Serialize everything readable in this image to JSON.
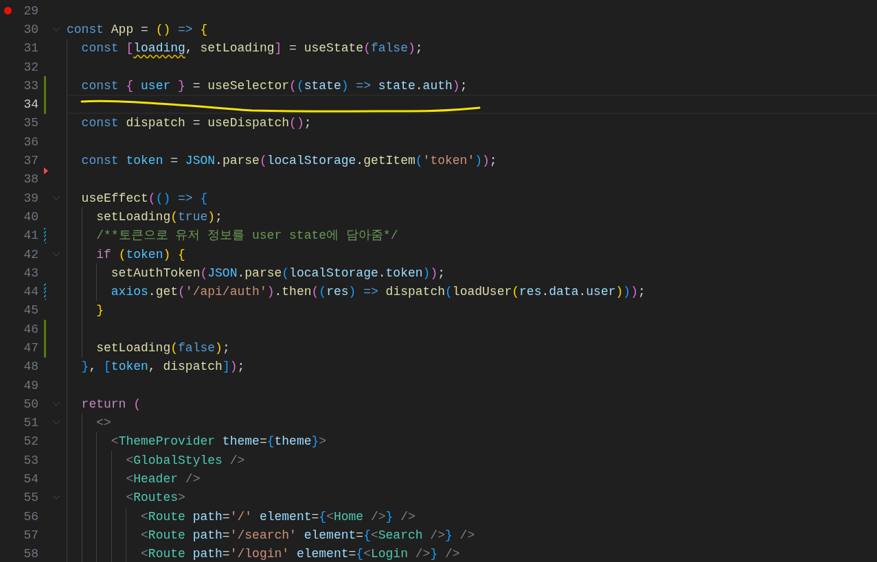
{
  "lines": [
    {
      "n": "29",
      "breakpoint": true
    },
    {
      "n": "30",
      "fold": true,
      "t": [
        {
          "text": "const ",
          "kind": "kw"
        },
        {
          "text": "App",
          "kind": "fn"
        },
        {
          "text": " = ",
          "kind": "p"
        },
        {
          "text": "()",
          "kind": "b1"
        },
        {
          "text": " => ",
          "kind": "kw"
        },
        {
          "text": "{",
          "kind": "b1"
        }
      ]
    },
    {
      "n": "31",
      "t": [
        {
          "text": "  const ",
          "kind": "kw"
        },
        {
          "text": "[",
          "kind": "b2"
        },
        {
          "text": "loading",
          "kind": "var-warn"
        },
        {
          "text": ", ",
          "kind": "p"
        },
        {
          "text": "setLoading",
          "kind": "fn"
        },
        {
          "text": "]",
          "kind": "b2"
        },
        {
          "text": " = ",
          "kind": "p"
        },
        {
          "text": "useState",
          "kind": "fn"
        },
        {
          "text": "(",
          "kind": "b2"
        },
        {
          "text": "false",
          "kind": "kw"
        },
        {
          "text": ")",
          "kind": "b2"
        },
        {
          "text": ";",
          "kind": "p"
        }
      ]
    },
    {
      "n": "32"
    },
    {
      "n": "33",
      "added": true,
      "t": [
        {
          "text": "  const ",
          "kind": "kw"
        },
        {
          "text": "{ ",
          "kind": "b2"
        },
        {
          "text": "user ",
          "kind": "cst"
        },
        {
          "text": "}",
          "kind": "b2"
        },
        {
          "text": " = ",
          "kind": "p"
        },
        {
          "text": "useSelector",
          "kind": "fn"
        },
        {
          "text": "(",
          "kind": "b2"
        },
        {
          "text": "(",
          "kind": "b3"
        },
        {
          "text": "state",
          "kind": "var"
        },
        {
          "text": ")",
          "kind": "b3"
        },
        {
          "text": " => ",
          "kind": "kw"
        },
        {
          "text": "state",
          "kind": "var"
        },
        {
          "text": ".",
          "kind": "p"
        },
        {
          "text": "auth",
          "kind": "var"
        },
        {
          "text": ")",
          "kind": "b2"
        },
        {
          "text": ";",
          "kind": "p"
        }
      ]
    },
    {
      "n": "34",
      "added": true,
      "current": true
    },
    {
      "n": "35",
      "t": [
        {
          "text": "  const ",
          "kind": "kw"
        },
        {
          "text": "dispatch",
          "kind": "fn"
        },
        {
          "text": " = ",
          "kind": "p"
        },
        {
          "text": "useDispatch",
          "kind": "fn"
        },
        {
          "text": "()",
          "kind": "b2"
        },
        {
          "text": ";",
          "kind": "p"
        }
      ]
    },
    {
      "n": "36"
    },
    {
      "n": "37",
      "deleted": true,
      "t": [
        {
          "text": "  const ",
          "kind": "kw"
        },
        {
          "text": "token",
          "kind": "cst"
        },
        {
          "text": " = ",
          "kind": "p"
        },
        {
          "text": "JSON",
          "kind": "cst"
        },
        {
          "text": ".",
          "kind": "p"
        },
        {
          "text": "parse",
          "kind": "fn"
        },
        {
          "text": "(",
          "kind": "b2"
        },
        {
          "text": "localStorage",
          "kind": "var"
        },
        {
          "text": ".",
          "kind": "p"
        },
        {
          "text": "getItem",
          "kind": "fn"
        },
        {
          "text": "(",
          "kind": "b3"
        },
        {
          "text": "'token'",
          "kind": "str"
        },
        {
          "text": ")",
          "kind": "b3"
        },
        {
          "text": ")",
          "kind": "b2"
        },
        {
          "text": ";",
          "kind": "p"
        }
      ]
    },
    {
      "n": "38"
    },
    {
      "n": "39",
      "fold": true,
      "t": [
        {
          "text": "  useEffect",
          "kind": "fn"
        },
        {
          "text": "(",
          "kind": "b2"
        },
        {
          "text": "()",
          "kind": "b3"
        },
        {
          "text": " => ",
          "kind": "kw"
        },
        {
          "text": "{",
          "kind": "b3"
        }
      ]
    },
    {
      "n": "40",
      "t": [
        {
          "text": "    setLoading",
          "kind": "fn"
        },
        {
          "text": "(",
          "kind": "b1"
        },
        {
          "text": "true",
          "kind": "kw"
        },
        {
          "text": ")",
          "kind": "b1"
        },
        {
          "text": ";",
          "kind": "p"
        }
      ]
    },
    {
      "n": "41",
      "modified": true,
      "t": [
        {
          "text": "    /**토큰으로 유저 정보를 user state에 담아줌*/",
          "kind": "cmt"
        }
      ]
    },
    {
      "n": "42",
      "fold": true,
      "t": [
        {
          "text": "    if ",
          "kind": "ctl"
        },
        {
          "text": "(",
          "kind": "b1"
        },
        {
          "text": "token",
          "kind": "cst"
        },
        {
          "text": ")",
          "kind": "b1"
        },
        {
          "text": " {",
          "kind": "b1"
        }
      ]
    },
    {
      "n": "43",
      "t": [
        {
          "text": "      setAuthToken",
          "kind": "fn"
        },
        {
          "text": "(",
          "kind": "b2"
        },
        {
          "text": "JSON",
          "kind": "cst"
        },
        {
          "text": ".",
          "kind": "p"
        },
        {
          "text": "parse",
          "kind": "fn"
        },
        {
          "text": "(",
          "kind": "b3"
        },
        {
          "text": "localStorage",
          "kind": "var"
        },
        {
          "text": ".",
          "kind": "p"
        },
        {
          "text": "token",
          "kind": "var"
        },
        {
          "text": ")",
          "kind": "b3"
        },
        {
          "text": ")",
          "kind": "b2"
        },
        {
          "text": ";",
          "kind": "p"
        }
      ]
    },
    {
      "n": "44",
      "modified": true,
      "t": [
        {
          "text": "      axios",
          "kind": "cst"
        },
        {
          "text": ".",
          "kind": "p"
        },
        {
          "text": "get",
          "kind": "fn"
        },
        {
          "text": "(",
          "kind": "b2"
        },
        {
          "text": "'/api/auth'",
          "kind": "str"
        },
        {
          "text": ")",
          "kind": "b2"
        },
        {
          "text": ".",
          "kind": "p"
        },
        {
          "text": "then",
          "kind": "fn"
        },
        {
          "text": "(",
          "kind": "b2"
        },
        {
          "text": "(",
          "kind": "b3"
        },
        {
          "text": "res",
          "kind": "var"
        },
        {
          "text": ")",
          "kind": "b3"
        },
        {
          "text": " => ",
          "kind": "kw"
        },
        {
          "text": "dispatch",
          "kind": "fn"
        },
        {
          "text": "(",
          "kind": "b3"
        },
        {
          "text": "loadUser",
          "kind": "fn"
        },
        {
          "text": "(",
          "kind": "b1"
        },
        {
          "text": "res",
          "kind": "var"
        },
        {
          "text": ".",
          "kind": "p"
        },
        {
          "text": "data",
          "kind": "var"
        },
        {
          "text": ".",
          "kind": "p"
        },
        {
          "text": "user",
          "kind": "var"
        },
        {
          "text": ")",
          "kind": "b1"
        },
        {
          "text": ")",
          "kind": "b3"
        },
        {
          "text": ")",
          "kind": "b2"
        },
        {
          "text": ";",
          "kind": "p"
        }
      ]
    },
    {
      "n": "45",
      "t": [
        {
          "text": "    }",
          "kind": "b1"
        }
      ]
    },
    {
      "n": "46",
      "added": true
    },
    {
      "n": "47",
      "added": true,
      "t": [
        {
          "text": "    setLoading",
          "kind": "fn"
        },
        {
          "text": "(",
          "kind": "b1"
        },
        {
          "text": "false",
          "kind": "kw"
        },
        {
          "text": ")",
          "kind": "b1"
        },
        {
          "text": ";",
          "kind": "p"
        }
      ]
    },
    {
      "n": "48",
      "t": [
        {
          "text": "  }",
          "kind": "b3"
        },
        {
          "text": ", ",
          "kind": "p"
        },
        {
          "text": "[",
          "kind": "b3"
        },
        {
          "text": "token",
          "kind": "cst"
        },
        {
          "text": ", ",
          "kind": "p"
        },
        {
          "text": "dispatch",
          "kind": "fn"
        },
        {
          "text": "]",
          "kind": "b3"
        },
        {
          "text": ")",
          "kind": "b2"
        },
        {
          "text": ";",
          "kind": "p"
        }
      ]
    },
    {
      "n": "49"
    },
    {
      "n": "50",
      "fold": true,
      "t": [
        {
          "text": "  return ",
          "kind": "ctl"
        },
        {
          "text": "(",
          "kind": "b2"
        }
      ]
    },
    {
      "n": "51",
      "fold": true,
      "t": [
        {
          "text": "    <>",
          "kind": "tb"
        }
      ]
    },
    {
      "n": "52",
      "t": [
        {
          "text": "      <",
          "kind": "tb"
        },
        {
          "text": "ThemeProvider",
          "kind": "tag"
        },
        {
          "text": " theme",
          "kind": "var"
        },
        {
          "text": "=",
          "kind": "p"
        },
        {
          "text": "{",
          "kind": "b3"
        },
        {
          "text": "theme",
          "kind": "var"
        },
        {
          "text": "}",
          "kind": "b3"
        },
        {
          "text": ">",
          "kind": "tb"
        }
      ]
    },
    {
      "n": "53",
      "t": [
        {
          "text": "        <",
          "kind": "tb"
        },
        {
          "text": "GlobalStyles",
          "kind": "tag"
        },
        {
          "text": " />",
          "kind": "tb"
        }
      ]
    },
    {
      "n": "54",
      "t": [
        {
          "text": "        <",
          "kind": "tb"
        },
        {
          "text": "Header",
          "kind": "tag"
        },
        {
          "text": " />",
          "kind": "tb"
        }
      ]
    },
    {
      "n": "55",
      "fold": true,
      "t": [
        {
          "text": "        <",
          "kind": "tb"
        },
        {
          "text": "Routes",
          "kind": "tag"
        },
        {
          "text": ">",
          "kind": "tb"
        }
      ]
    },
    {
      "n": "56",
      "t": [
        {
          "text": "          <",
          "kind": "tb"
        },
        {
          "text": "Route",
          "kind": "tag"
        },
        {
          "text": " path",
          "kind": "var"
        },
        {
          "text": "=",
          "kind": "p"
        },
        {
          "text": "'/'",
          "kind": "str"
        },
        {
          "text": " element",
          "kind": "var"
        },
        {
          "text": "=",
          "kind": "p"
        },
        {
          "text": "{",
          "kind": "b3"
        },
        {
          "text": "<",
          "kind": "tb"
        },
        {
          "text": "Home",
          "kind": "tag"
        },
        {
          "text": " />",
          "kind": "tb"
        },
        {
          "text": "}",
          "kind": "b3"
        },
        {
          "text": " />",
          "kind": "tb"
        }
      ]
    },
    {
      "n": "57",
      "t": [
        {
          "text": "          <",
          "kind": "tb"
        },
        {
          "text": "Route",
          "kind": "tag"
        },
        {
          "text": " path",
          "kind": "var"
        },
        {
          "text": "=",
          "kind": "p"
        },
        {
          "text": "'/search'",
          "kind": "str"
        },
        {
          "text": " element",
          "kind": "var"
        },
        {
          "text": "=",
          "kind": "p"
        },
        {
          "text": "{",
          "kind": "b3"
        },
        {
          "text": "<",
          "kind": "tb"
        },
        {
          "text": "Search",
          "kind": "tag"
        },
        {
          "text": " />",
          "kind": "tb"
        },
        {
          "text": "}",
          "kind": "b3"
        },
        {
          "text": " />",
          "kind": "tb"
        }
      ]
    },
    {
      "n": "58",
      "t": [
        {
          "text": "          <",
          "kind": "tb"
        },
        {
          "text": "Route",
          "kind": "tag"
        },
        {
          "text": " path",
          "kind": "var"
        },
        {
          "text": "=",
          "kind": "p"
        },
        {
          "text": "'/login'",
          "kind": "str"
        },
        {
          "text": " element",
          "kind": "var"
        },
        {
          "text": "=",
          "kind": "p"
        },
        {
          "text": "{",
          "kind": "b3"
        },
        {
          "text": "<",
          "kind": "tb"
        },
        {
          "text": "Login",
          "kind": "tag"
        },
        {
          "text": " />",
          "kind": "tb"
        },
        {
          "text": "}",
          "kind": "b3"
        },
        {
          "text": " />",
          "kind": "tb"
        }
      ]
    }
  ]
}
